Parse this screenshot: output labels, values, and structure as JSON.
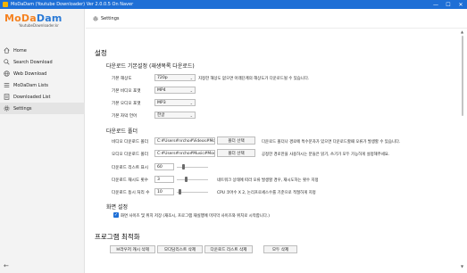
{
  "window": {
    "title": "MoDaDam (Youtube Downloader) Ver 2.0.0.5 On Naver",
    "minimize_glyph": "—",
    "maximize_glyph": "☐",
    "close_glyph": "✕"
  },
  "sidebar": {
    "logo_brand_part1": "MoDa",
    "logo_brand_part2": "Dam",
    "logo_tagline": "YoutubeDownloader.kr",
    "items": [
      {
        "label": "Home",
        "icon": "home-icon"
      },
      {
        "label": "Search Download",
        "icon": "search-download-icon"
      },
      {
        "label": "Web Download",
        "icon": "web-download-icon"
      },
      {
        "label": "MoDaDam Lists",
        "icon": "list-icon"
      },
      {
        "label": "Downloaded List",
        "icon": "downloaded-list-icon"
      },
      {
        "label": "Settings",
        "icon": "gear-icon"
      }
    ],
    "active_index": 5,
    "back_glyph": "←"
  },
  "header": {
    "label": "Settings"
  },
  "settings": {
    "section_title": "설정",
    "download_defaults": {
      "title": "다운로드 기본설정 (재생목록 다운로드)",
      "resolution_label": "기본 해상도",
      "resolution_value": "720p",
      "resolution_hint": "지정한 해상도 없으면 아래단계의 해상도가 다운로드될 수 있습니다.",
      "video_format_label": "기본 비디오 포맷",
      "video_format_value": "MP4",
      "audio_format_label": "기본 오디오 포맷",
      "audio_format_value": "MP3",
      "subtitle_lang_label": "기본 자막 언어",
      "subtitle_lang_value": "한글"
    },
    "download_folder": {
      "title": "다운로드 폴더",
      "video_folder_label": "비디오 다운로드 폴더",
      "video_folder_value": "C:#Users#nrcho#Videos#ModaDa",
      "video_folder_button": "폴더 선택",
      "video_folder_hint": "다운로드 폴더나 경로에 특수문자가 있으면 다운로드할때 오류가 발생할 수 있습니다.",
      "audio_folder_label": "오디오 다운로드 폴더",
      "audio_folder_value": "C:#Users#nrcho#Music#ModaDa",
      "audio_folder_button": "폴더 선택",
      "audio_folder_hint": "공정한 경로만을 사용하시는 분들은 읽기, 쓰기가 모두 가능하게 설정해주세요.",
      "list_display_label": "다운로드 리스트 표시",
      "list_display_value": "60",
      "list_display_level": 0.2,
      "retry_label": "다운로드 재시도 횟수",
      "retry_value": "3",
      "retry_level": 0.3,
      "retry_hint": "네트워크 상태에 따라 오류 발생할 경우, 재시도하는 횟수 지정",
      "concurrent_label": "다운로드 동시 처리 수",
      "concurrent_value": "10",
      "concurrent_level": 0.1,
      "concurrent_hint": "CPU 코어수 X 2, 논리프로세스수를 기준으로 적절하게 지정"
    },
    "screen": {
      "title": "화면 설정",
      "checkbox_checked": true,
      "checkbox_label": "화면 사이즈 및 위치 저장 (재조시, 프로그램 재실행에 마지막 사이즈와 위치로 시작합니다.)"
    },
    "optimize": {
      "title": "프로그램 최적화",
      "buttons": [
        "브라우저 캐시 삭제",
        "모다담리스트 삭제",
        "다운로드 리스트 삭제",
        "모두 삭제"
      ]
    }
  },
  "scrollbar": {
    "up_glyph": "▲",
    "down_glyph": "▼"
  }
}
